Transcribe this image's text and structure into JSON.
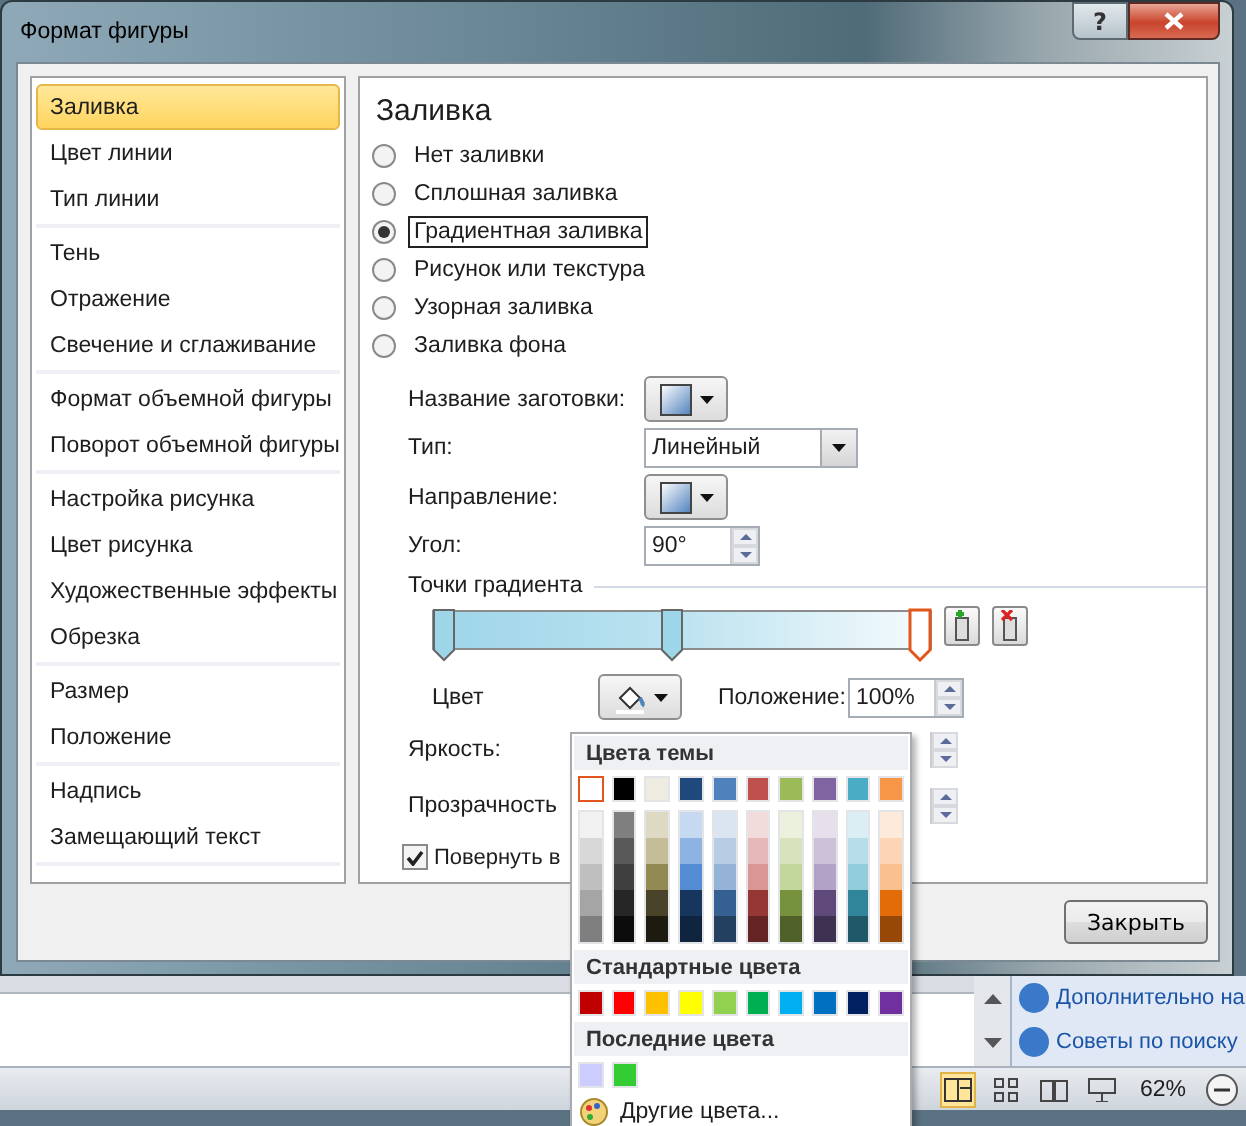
{
  "window": {
    "title": "Формат фигуры",
    "help_button": "?"
  },
  "sidebar": {
    "groups": [
      {
        "items": [
          {
            "label": "Заливка",
            "selected": true
          },
          {
            "label": "Цвет линии",
            "selected": false
          },
          {
            "label": "Тип линии",
            "selected": false
          }
        ]
      },
      {
        "items": [
          {
            "label": "Тень",
            "selected": false
          },
          {
            "label": "Отражение",
            "selected": false
          },
          {
            "label": "Свечение и сглаживание",
            "selected": false
          }
        ]
      },
      {
        "items": [
          {
            "label": "Формат объемной фигуры",
            "selected": false
          },
          {
            "label": "Поворот объемной фигуры",
            "selected": false
          }
        ]
      },
      {
        "items": [
          {
            "label": "Настройка рисунка",
            "selected": false
          },
          {
            "label": "Цвет рисунка",
            "selected": false
          },
          {
            "label": "Художественные эффекты",
            "selected": false
          },
          {
            "label": "Обрезка",
            "selected": false
          }
        ]
      },
      {
        "items": [
          {
            "label": "Размер",
            "selected": false
          },
          {
            "label": "Положение",
            "selected": false
          }
        ]
      },
      {
        "items": [
          {
            "label": "Надпись",
            "selected": false
          },
          {
            "label": "Замещающий текст",
            "selected": false
          }
        ]
      }
    ]
  },
  "panel": {
    "heading": "Заливка",
    "fill_options": [
      {
        "label": "Нет заливки",
        "selected": false
      },
      {
        "label": "Сплошная заливка",
        "selected": false
      },
      {
        "label": "Градиентная заливка",
        "selected": true
      },
      {
        "label": "Рисунок или текстура",
        "selected": false
      },
      {
        "label": "Узорная заливка",
        "selected": false
      },
      {
        "label": "Заливка фона",
        "selected": false
      }
    ],
    "preset_label": "Название заготовки:",
    "type_label": "Тип:",
    "type_value": "Линейный",
    "direction_label": "Направление:",
    "angle_label": "Угол:",
    "angle_value": "90°",
    "stops_heading": "Точки градиента",
    "stops": [
      {
        "level": 0,
        "selected": false
      },
      {
        "level": 0.48,
        "selected": false
      },
      {
        "level": 1,
        "selected": true
      }
    ],
    "color_label": "Цвет",
    "position_label": "Положение:",
    "position_value": "100%",
    "brightness_label": "Яркость:",
    "transparency_label": "Прозрачность",
    "rotate": {
      "label": "Повернуть в",
      "checked": true
    }
  },
  "close_button": "Закрыть",
  "color_menu": {
    "theme_heading": "Цвета темы",
    "theme_colors": [
      {
        "color": "#ffffff",
        "selected": true
      },
      {
        "color": "#000000",
        "selected": false
      },
      {
        "color": "#eeece1",
        "selected": false
      },
      {
        "color": "#1f497d",
        "selected": false
      },
      {
        "color": "#4f81bd",
        "selected": false
      },
      {
        "color": "#c0504d",
        "selected": false
      },
      {
        "color": "#9bbb59",
        "selected": false
      },
      {
        "color": "#8064a2",
        "selected": false
      },
      {
        "color": "#4bacc6",
        "selected": false
      },
      {
        "color": "#f79646",
        "selected": false
      }
    ],
    "shades": [
      {
        "cells": [
          {
            "color": "#f2f2f2"
          },
          {
            "color": "#d8d8d8"
          },
          {
            "color": "#bfbfbf"
          },
          {
            "color": "#a5a5a5"
          },
          {
            "color": "#7f7f7f"
          }
        ]
      },
      {
        "cells": [
          {
            "color": "#7f7f7f"
          },
          {
            "color": "#595959"
          },
          {
            "color": "#3f3f3f"
          },
          {
            "color": "#262626"
          },
          {
            "color": "#0c0c0c"
          }
        ]
      },
      {
        "cells": [
          {
            "color": "#ddd9c3"
          },
          {
            "color": "#c4bd97"
          },
          {
            "color": "#938953"
          },
          {
            "color": "#494429"
          },
          {
            "color": "#1d1b10"
          }
        ]
      },
      {
        "cells": [
          {
            "color": "#c6d9f0"
          },
          {
            "color": "#8db3e2"
          },
          {
            "color": "#548dd4"
          },
          {
            "color": "#17365d"
          },
          {
            "color": "#0f243e"
          }
        ]
      },
      {
        "cells": [
          {
            "color": "#dbe5f1"
          },
          {
            "color": "#b8cce4"
          },
          {
            "color": "#95b3d7"
          },
          {
            "color": "#366092"
          },
          {
            "color": "#244061"
          }
        ]
      },
      {
        "cells": [
          {
            "color": "#f2dcdb"
          },
          {
            "color": "#e5b9b7"
          },
          {
            "color": "#d99694"
          },
          {
            "color": "#953734"
          },
          {
            "color": "#632423"
          }
        ]
      },
      {
        "cells": [
          {
            "color": "#ebf1dd"
          },
          {
            "color": "#d7e3bc"
          },
          {
            "color": "#c3d69b"
          },
          {
            "color": "#76923c"
          },
          {
            "color": "#4f6128"
          }
        ]
      },
      {
        "cells": [
          {
            "color": "#e5e0ec"
          },
          {
            "color": "#ccc1d9"
          },
          {
            "color": "#b2a2c7"
          },
          {
            "color": "#5f497a"
          },
          {
            "color": "#3f3151"
          }
        ]
      },
      {
        "cells": [
          {
            "color": "#dbeef3"
          },
          {
            "color": "#b7dde8"
          },
          {
            "color": "#92cddc"
          },
          {
            "color": "#31859b"
          },
          {
            "color": "#205867"
          }
        ]
      },
      {
        "cells": [
          {
            "color": "#fdeada"
          },
          {
            "color": "#fbd5b5"
          },
          {
            "color": "#fac08f"
          },
          {
            "color": "#e36c09"
          },
          {
            "color": "#974806"
          }
        ]
      }
    ],
    "standard_heading": "Стандартные цвета",
    "standard_colors": [
      {
        "color": "#c00000"
      },
      {
        "color": "#ff0000"
      },
      {
        "color": "#ffc000"
      },
      {
        "color": "#ffff00"
      },
      {
        "color": "#92d050"
      },
      {
        "color": "#00b050"
      },
      {
        "color": "#00b0f0"
      },
      {
        "color": "#0070c0"
      },
      {
        "color": "#002060"
      },
      {
        "color": "#7030a0"
      }
    ],
    "recent_heading": "Последние цвета",
    "recent_colors": [
      {
        "color": "#ccccff"
      },
      {
        "color": "#33cc33"
      }
    ],
    "more_colors": "Другие цвета..."
  },
  "task_pane": {
    "links": [
      "Дополнительно на",
      "Советы по поиску"
    ]
  },
  "status_bar": {
    "zoom": "62%"
  }
}
